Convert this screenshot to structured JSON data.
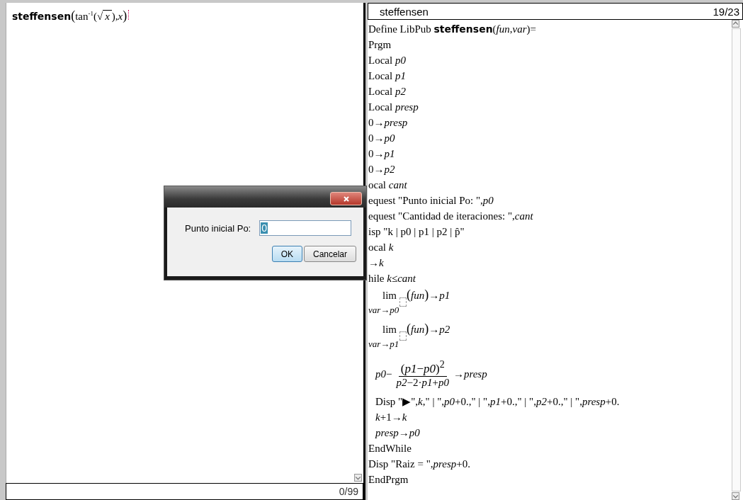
{
  "calculator": {
    "entry": {
      "name": "steffensen",
      "open": "(",
      "expression": "tan$^{-1}$(",
      "root": "√",
      "radicand": "*x*",
      "tail": "),*x*",
      "close": ")"
    },
    "status": "0/99"
  },
  "editor": {
    "title": "steffensen",
    "position": "19/23",
    "lines": [
      {
        "kind": "text",
        "text": "Define LibPub **steffensen**(*fun*,*var*)="
      },
      {
        "kind": "text",
        "text": "Prgm"
      },
      {
        "kind": "text",
        "text": "Local *p0*"
      },
      {
        "kind": "text",
        "text": "Local *p1*"
      },
      {
        "kind": "text",
        "text": "Local *p2*"
      },
      {
        "kind": "text",
        "text": "Local *presp*"
      },
      {
        "kind": "text",
        "text": "0→*presp*"
      },
      {
        "kind": "text",
        "text": "0→*p0*"
      },
      {
        "kind": "text",
        "text": "0→*p1*"
      },
      {
        "kind": "text",
        "text": "0→*p2*"
      },
      {
        "kind": "text",
        "text": "ocal *cant*"
      },
      {
        "kind": "text",
        "text": "equest \"Punto inicial Po: \",*p0*"
      },
      {
        "kind": "text",
        "text": "equest \"Cantidad de iteraciones: \",*cant*"
      },
      {
        "kind": "text",
        "text": "isp \"k    | p0    | p1    | p2    | p̂\""
      },
      {
        "kind": "text",
        "text": "ocal *k*"
      },
      {
        "kind": "text",
        "text": "→*k*"
      },
      {
        "kind": "text",
        "text": "hile *k*≤*cant*",
        "children": [
          {
            "kind": "limit",
            "operator": "lim",
            "open": "(",
            "body": "*fun*",
            "close": ")",
            "result": "→*p1*",
            "subscript": "*var*→*p0*"
          },
          {
            "kind": "limit",
            "operator": "lim",
            "open": "(",
            "body": "*fun*",
            "close": ")",
            "result": "→*p2*",
            "subscript": "*var*→*p1*"
          },
          {
            "kind": "fraction",
            "prefix": "*p0*−",
            "numerator": "(*p1*−*p0*)$^{2}$",
            "denominator": "*p2*−2·*p1*+*p0*",
            "result": "→*presp*"
          },
          {
            "kind": "text",
            "text": "Disp \"▶\",*k*,\" | \",*p0*+0.,\" | \",*p1*+0.,\" | \",*p2*+0.,\" | \",*presp*+0."
          },
          {
            "kind": "text",
            "text": "*k*+1→*k*"
          },
          {
            "kind": "text",
            "text": "*presp*→*p0*"
          }
        ]
      },
      {
        "kind": "text",
        "text": "EndWhile"
      },
      {
        "kind": "text",
        "text": "Disp \"Raiz = \",*presp*+0."
      },
      {
        "kind": "text",
        "text": "EndPrgm"
      }
    ]
  },
  "dialog": {
    "label": "Punto inicial Po:",
    "value": "0",
    "buttons": [
      {
        "label": "OK",
        "default": true
      },
      {
        "label": "Cancelar",
        "default": false
      }
    ]
  }
}
